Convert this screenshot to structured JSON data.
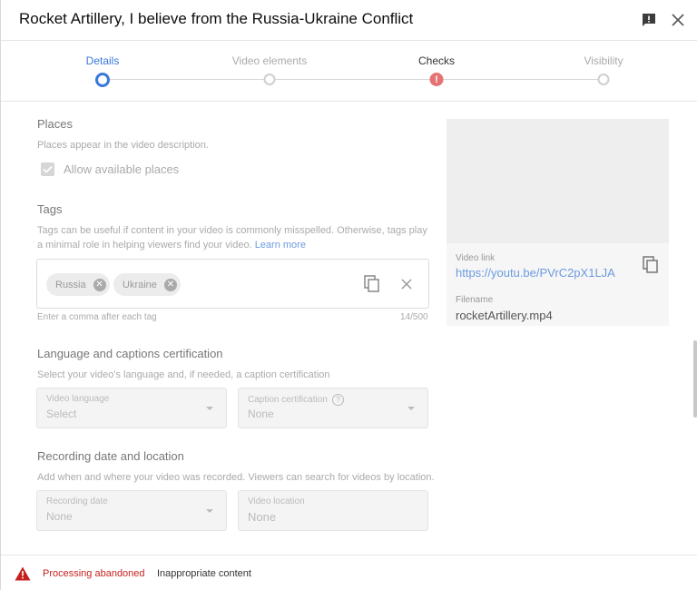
{
  "dialog": {
    "title": "Rocket Artillery, I believe from the Russia-Ukraine Conflict"
  },
  "stepper": {
    "steps": [
      {
        "label": "Details",
        "state": "active"
      },
      {
        "label": "Video elements",
        "state": "inactive"
      },
      {
        "label": "Checks",
        "state": "error",
        "marker": "!"
      },
      {
        "label": "Visibility",
        "state": "inactive"
      }
    ]
  },
  "places": {
    "title": "Places",
    "description": "Places appear in the video description.",
    "checkbox_label": "Allow available places",
    "checked": true
  },
  "tags": {
    "title": "Tags",
    "description": "Tags can be useful if content in your video is commonly misspelled. Otherwise, tags play a minimal role in helping viewers find your video.",
    "learn_more": "Learn more",
    "chips": [
      "Russia",
      "Ukraine"
    ],
    "hint": "Enter a comma after each tag",
    "count": "14/500"
  },
  "language": {
    "title": "Language and captions certification",
    "description": "Select your video's language and, if needed, a caption certification",
    "video_language_label": "Video language",
    "video_language_value": "Select",
    "caption_label": "Caption certification",
    "caption_value": "None",
    "help_glyph": "?"
  },
  "recording": {
    "title": "Recording date and location",
    "description": "Add when and where your video was recorded. Viewers can search for videos by location.",
    "date_label": "Recording date",
    "date_value": "None",
    "location_placeholder": "Video location",
    "location_value": "None"
  },
  "preview": {
    "video_link_label": "Video link",
    "video_link": "https://youtu.be/PVrC2pX1LJA",
    "filename_label": "Filename",
    "filename": "rocketArtillery.mp4"
  },
  "footer": {
    "status": "Processing abandoned",
    "detail": "Inappropriate content"
  },
  "colors": {
    "accent": "#3b78d8",
    "error": "#e57373",
    "warning": "#c5221f",
    "link": "#6b9be0"
  }
}
